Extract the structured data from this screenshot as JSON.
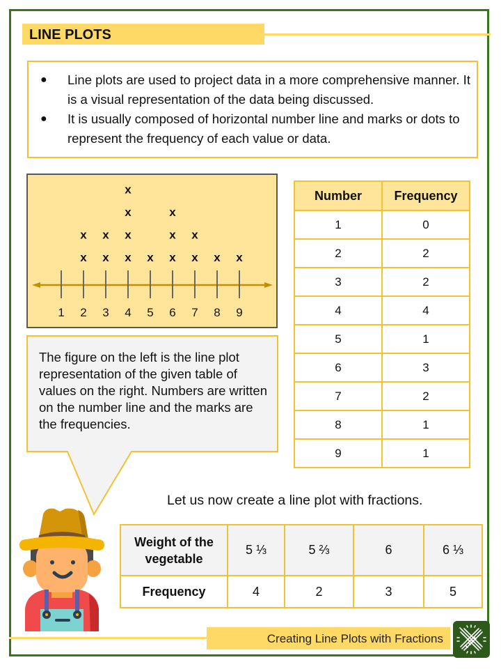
{
  "header": {
    "title": "LINE PLOTS"
  },
  "info": {
    "bullets": [
      "Line plots are used to project data in a more comprehensive manner. It is a visual representation of the data being discussed.",
      "It is usually composed of horizontal number line and marks or dots to represent the frequency of each value or data."
    ],
    "bullet_glyph": "●"
  },
  "chart_data": {
    "type": "line-plot",
    "title": "",
    "xlabel": "",
    "ylabel": "",
    "mark": "x",
    "categories": [
      "1",
      "2",
      "3",
      "4",
      "5",
      "6",
      "7",
      "8",
      "9"
    ],
    "values": [
      0,
      2,
      2,
      4,
      1,
      3,
      2,
      1,
      1
    ],
    "axis": {
      "arrows": "both",
      "color": "#bf9000"
    },
    "grid": false
  },
  "frequency_table": {
    "headers": [
      "Number",
      "Frequency"
    ],
    "rows": [
      [
        "1",
        "0"
      ],
      [
        "2",
        "2"
      ],
      [
        "3",
        "2"
      ],
      [
        "4",
        "4"
      ],
      [
        "5",
        "1"
      ],
      [
        "6",
        "3"
      ],
      [
        "7",
        "2"
      ],
      [
        "8",
        "1"
      ],
      [
        "9",
        "1"
      ]
    ]
  },
  "callout": {
    "text": "The figure on the left is the line plot representation of the given table of values on the right. Numbers are written on the number line and the marks are the frequencies."
  },
  "fractions": {
    "intro": "Let us now create a line plot with fractions.",
    "row_labels": [
      "Weight of the vegetable",
      "Frequency"
    ],
    "weights": [
      "5 ⅓",
      "5 ⅔",
      "6",
      "6 ⅓"
    ],
    "frequencies": [
      "4",
      "2",
      "3",
      "5"
    ]
  },
  "footer": {
    "title": "Creating Line Plots with Fractions",
    "icon": "pencil-ruler-icon"
  },
  "colors": {
    "frame": "#38761d",
    "accent_yellow": "#ffd966",
    "light_yellow": "#ffe599",
    "border_gold": "#f1c232",
    "icon_green": "#2d5a1b"
  }
}
